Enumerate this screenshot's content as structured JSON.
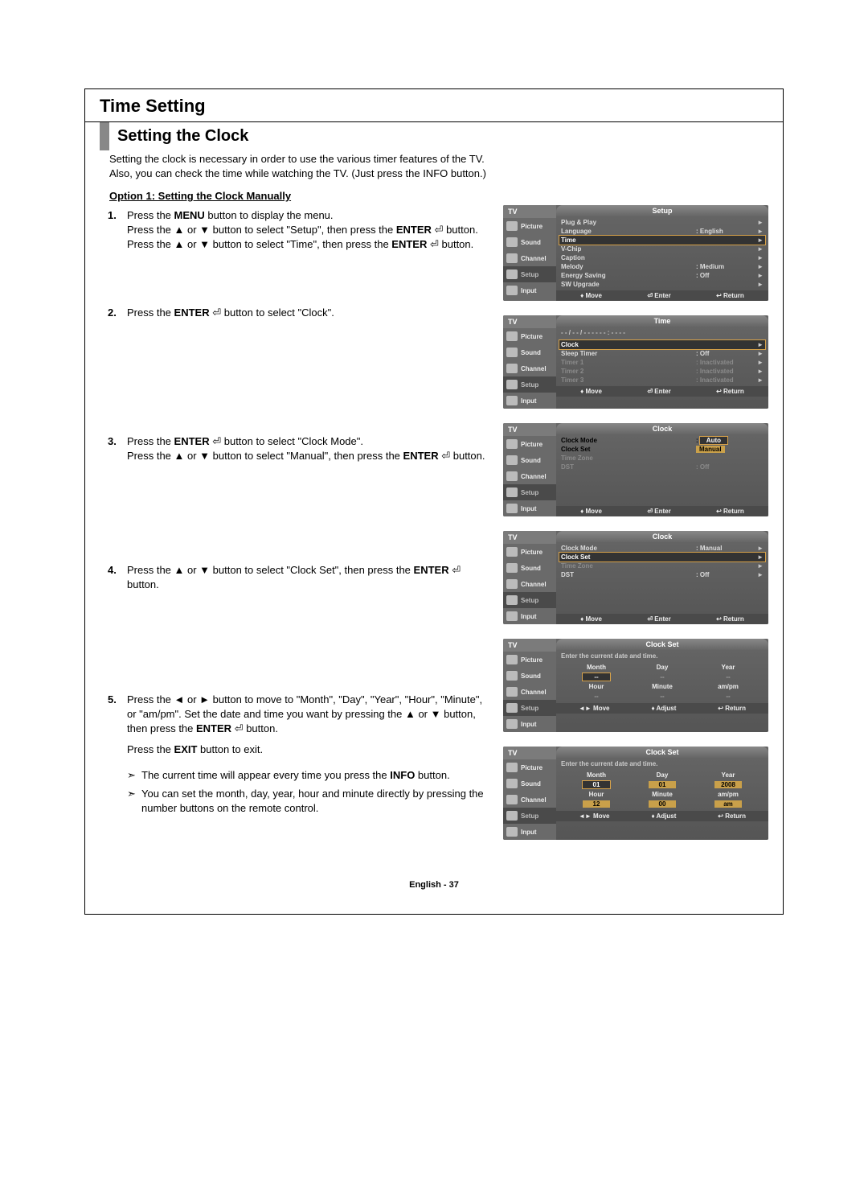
{
  "page": {
    "section_title": "Time Setting",
    "sub_title": "Setting the Clock",
    "intro1": "Setting the clock is necessary in order to use the various timer features of the TV.",
    "intro2": "Also, you can check the time while watching the TV. (Just press the INFO button.)",
    "option_heading": "Option 1: Setting the Clock Manually",
    "footer": "English - 37"
  },
  "steps": {
    "s1_num": "1.",
    "s1_l1a": "Press the ",
    "s1_l1b": "MENU",
    "s1_l1c": " button to display the menu.",
    "s1_l2a": "Press the ▲ or ▼ button to select \"Setup\", then press the ",
    "s1_l2b": "ENTER",
    "s1_l2c": " ",
    "s1_l2d": " button.",
    "s1_l3a": "Press the ▲ or ▼ button to select \"Time\", then press the ",
    "s1_l3b": "ENTER",
    "s1_l3c": " ",
    "s1_l3d": " button.",
    "s2_num": "2.",
    "s2_l1a": "Press the ",
    "s2_l1b": "ENTER",
    "s2_l1c": " ",
    "s2_l1d": " button to select \"Clock\".",
    "s3_num": "3.",
    "s3_l1a": "Press the ",
    "s3_l1b": "ENTER",
    "s3_l1c": " ",
    "s3_l1d": " button to select \"Clock Mode\".",
    "s3_l2a": "Press the ▲ or ▼ button to select \"Manual\", then press the ",
    "s3_l2b": "ENTER",
    "s3_l2c": " ",
    "s3_l2d": " button.",
    "s4_num": "4.",
    "s4_l1a": "Press the ▲ or ▼ button to select \"Clock Set\", then press the ",
    "s4_l1b": "ENTER",
    "s4_l1c": " ",
    "s4_l2": "button.",
    "s5_num": "5.",
    "s5_l1": "Press the ◄ or ► button to move to \"Month\", \"Day\", \"Year\", \"Hour\", \"Minute\", or \"am/pm\". Set the date and time you want by pressing the ▲ or ▼ button, then press the ",
    "s5_l1b": "ENTER",
    "s5_l1c": " ",
    "s5_l1d": " button.",
    "s5_l2a": "Press the ",
    "s5_l2b": "EXIT",
    "s5_l2c": " button to exit.",
    "note1a": "The current time will appear every time you press the ",
    "note1b": "INFO",
    "note1c": " button.",
    "note2": "You can set the month, day, year, hour and minute directly by pressing the number buttons on the remote control."
  },
  "enter_glyph": "⏎",
  "arrow_glyph": "➣",
  "osd": {
    "tv": "TV",
    "tabs": {
      "picture": "Picture",
      "sound": "Sound",
      "channel": "Channel",
      "setup": "Setup",
      "input": "Input"
    },
    "foot": {
      "move": "Move",
      "enter": "Enter",
      "return": "Return",
      "adjust": "Adjust",
      "move_sym": "♦",
      "enter_sym": "⏎",
      "return_sym": "↩",
      "lr_sym": "◄►"
    },
    "setup": {
      "title": "Setup",
      "plug": "Plug & Play",
      "lang_k": "Language",
      "lang_v": ": English",
      "time": "Time",
      "vchip": "V-Chip",
      "caption": "Caption",
      "melody_k": "Melody",
      "melody_v": ": Medium",
      "energy_k": "Energy Saving",
      "energy_v": ": Off",
      "sw": "SW Upgrade"
    },
    "time": {
      "title": "Time",
      "banner": "- - / - - / - - - -   - - : - -   - -",
      "clock": "Clock",
      "sleep_k": "Sleep Timer",
      "sleep_v": ": Off",
      "t1_k": "Timer 1",
      "t1_v": ": Inactivated",
      "t2_k": "Timer 2",
      "t2_v": ": Inactivated",
      "t3_k": "Timer 3",
      "t3_v": ": Inactivated"
    },
    "clock_a": {
      "title": "Clock",
      "mode_k": "Clock Mode",
      "mode_v": ":",
      "auto": "Auto",
      "manual": "Manual",
      "set_k": "Clock Set",
      "tz_k": "Time Zone",
      "dst_k": "DST",
      "dst_v": ": Off"
    },
    "clock_b": {
      "title": "Clock",
      "mode_k": "Clock Mode",
      "mode_v": ": Manual",
      "set_k": "Clock Set",
      "tz_k": "Time Zone",
      "dst_k": "DST",
      "dst_v": ": Off"
    },
    "clockset": {
      "title": "Clock Set",
      "prompt": "Enter the current date and time.",
      "month": "Month",
      "day": "Day",
      "year": "Year",
      "hour": "Hour",
      "minute": "Minute",
      "ampm": "am/pm",
      "dash": "--",
      "v_month": "01",
      "v_day": "01",
      "v_year": "2008",
      "v_hour": "12",
      "v_min": "00",
      "v_ampm": "am"
    }
  }
}
